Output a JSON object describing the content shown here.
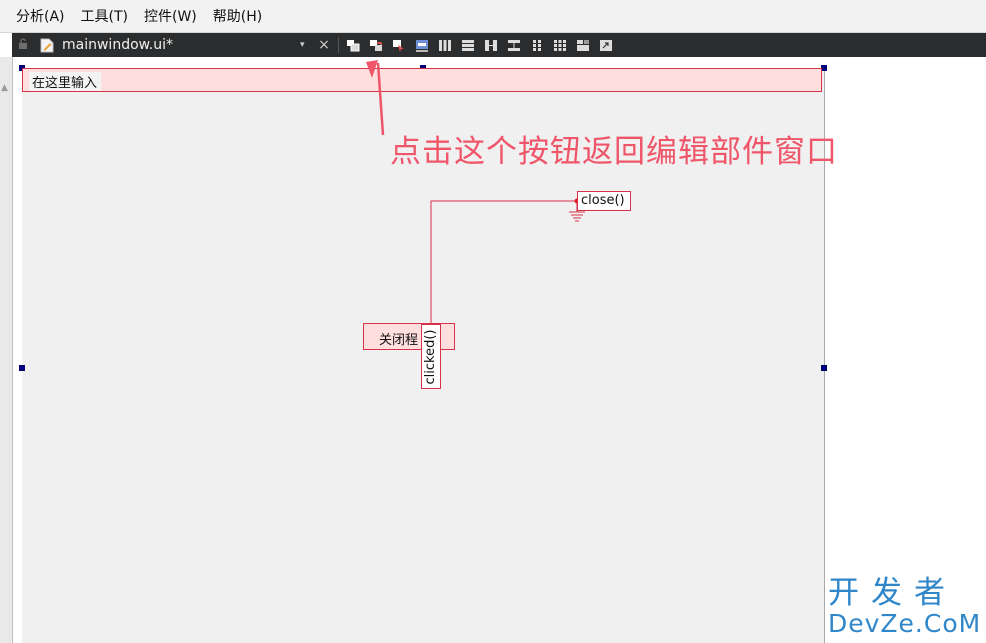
{
  "menubar": {
    "items": [
      "分析(A)",
      "工具(T)",
      "控件(W)",
      "帮助(H)"
    ]
  },
  "tab": {
    "title": "mainwindow.ui*",
    "dropdown": "▾",
    "close": "×"
  },
  "toolbar": {
    "buttons": [
      "edit-widgets-icon",
      "edit-signals-slots-icon",
      "edit-buddies-icon",
      "edit-tab-order-icon",
      "layout-horizontal-icon",
      "layout-vertical-icon",
      "layout-horizontal-splitter-icon",
      "layout-vertical-splitter-icon",
      "layout-form-icon",
      "layout-grid-icon",
      "break-layout-icon",
      "adjust-size-icon"
    ]
  },
  "form": {
    "lineedit_text": "在这里输入",
    "button_text": "关闭程",
    "signal_text": "clicked()",
    "slot_text": "close()"
  },
  "annotation": {
    "text": "点击这个按钮返回编辑部件窗口",
    "color": "#f0566a"
  },
  "watermark": {
    "cn": "开发者",
    "en": "DevZe.CoM",
    "color": "#2f86c9"
  },
  "colors": {
    "selection_border": "#d8324a",
    "selection_fill": "#ffdede",
    "handle": "#00007a",
    "tabbar_bg": "#2b2d2f"
  }
}
